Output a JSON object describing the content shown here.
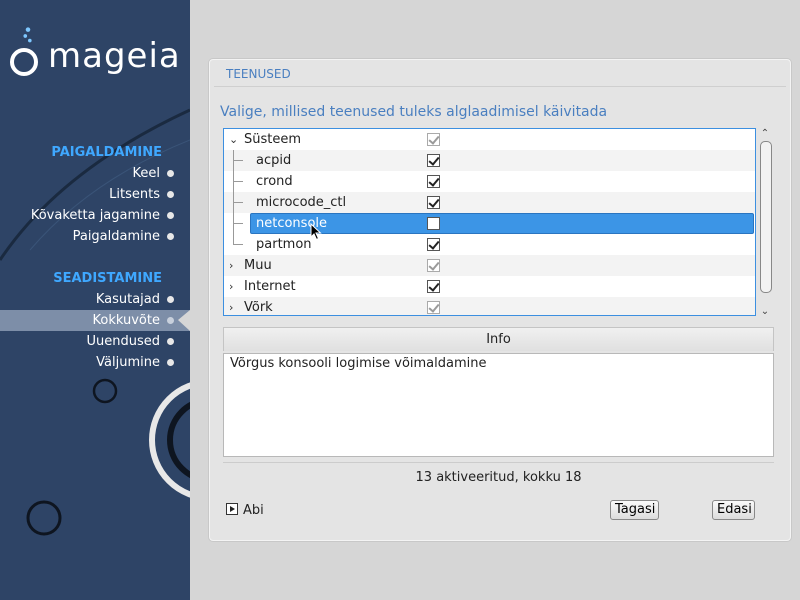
{
  "sidebar": {
    "logo_text": "mageia",
    "sections": [
      {
        "title": "PAIGALDAMINE",
        "items": [
          "Keel",
          "Litsents",
          "Kõvaketta jagamine",
          "Paigaldamine"
        ]
      },
      {
        "title": "SEADISTAMINE",
        "items": [
          "Kasutajad",
          "Kokkuvõte",
          "Uuendused",
          "Väljumine"
        ],
        "active": "Kokkuvõte"
      }
    ]
  },
  "panel": {
    "title": "TEENUSED",
    "subtitle": "Valige, millised teenused tuleks alglaadimisel käivitada"
  },
  "tree": {
    "rows": [
      {
        "label": "Süsteem",
        "level": 0,
        "expander": "down",
        "checked": true,
        "disabled": true
      },
      {
        "label": "acpid",
        "level": 1,
        "checked": true
      },
      {
        "label": "crond",
        "level": 1,
        "checked": true
      },
      {
        "label": "microcode_ctl",
        "level": 1,
        "checked": true
      },
      {
        "label": "netconsole",
        "level": 1,
        "checked": false,
        "selected": true
      },
      {
        "label": "partmon",
        "level": 1,
        "checked": true,
        "last": true
      },
      {
        "label": "Muu",
        "level": 0,
        "expander": "right",
        "checked": true,
        "disabled": true
      },
      {
        "label": "Internet",
        "level": 0,
        "expander": "right",
        "checked": true
      },
      {
        "label": "Võrk",
        "level": 0,
        "expander": "right",
        "checked": true,
        "disabled": true
      }
    ]
  },
  "info": {
    "header": "Info",
    "text": "Võrgus konsooli logimise võimaldamine"
  },
  "status": "13 aktiveeritud, kokku 18",
  "buttons": {
    "help": "Abi",
    "back": "Tagasi",
    "next": "Edasi"
  },
  "colors": {
    "sidebar_bg": "#2e4466",
    "section_title": "#3fa8ff",
    "accent_text": "#4a7fc0",
    "selection": "#3c95e6"
  }
}
